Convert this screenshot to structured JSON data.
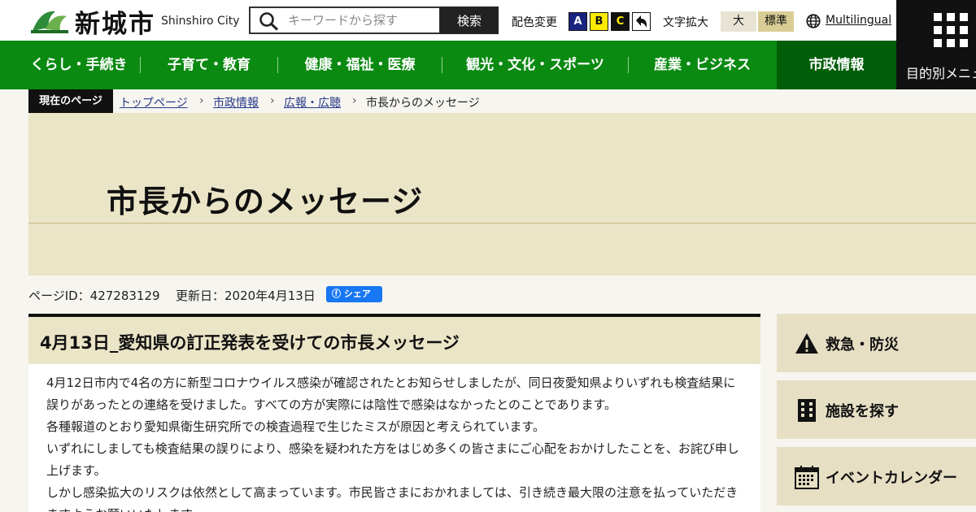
{
  "header": {
    "site_name": "新城市",
    "site_name_en": "Shinshiro City",
    "search": {
      "placeholder": "キーワードから探す",
      "button_label": "検索"
    },
    "color_change": {
      "label": "配色変更",
      "options": [
        "A",
        "B",
        "C"
      ]
    },
    "font_size": {
      "label": "文字拡大",
      "large_label": "大",
      "standard_label": "標準"
    },
    "multilingual_label": "Multilingual",
    "purpose_menu_label": "目的別メニュー"
  },
  "global_nav": {
    "items": [
      {
        "label": "くらし・手続き"
      },
      {
        "label": "子育て・教育"
      },
      {
        "label": "健康・福祉・医療"
      },
      {
        "label": "観光・文化・スポーツ"
      },
      {
        "label": "産業・ビジネス"
      },
      {
        "label": "市政情報"
      }
    ]
  },
  "breadcrumb": {
    "current_label": "現在のページ",
    "items": [
      {
        "label": "トップページ"
      },
      {
        "label": "市政情報"
      },
      {
        "label": "広報・広聴"
      },
      {
        "label": "市長からのメッセージ"
      }
    ]
  },
  "hero": {
    "title": "市長からのメッセージ"
  },
  "meta": {
    "page_id": "ページID：427283129",
    "updated": "更新日：2020年4月13日",
    "share_label": "シェア"
  },
  "article": {
    "title": "4月13日_愛知県の訂正発表を受けての市長メッセージ",
    "paragraphs": [
      "4月12日市内で4名の方に新型コロナウイルス感染が確認されたとお知らせしましたが、同日夜愛知県よりいずれも検査結果に誤りがあったとの連絡を受けました。すべての方が実際には陰性で感染はなかったとのことであります。",
      "各種報道のとおり愛知県衛生研究所での検査過程で生じたミスが原因と考えられています。",
      "いずれにしましても検査結果の誤りにより、感染を疑われた方をはじめ多くの皆さまにご心配をおかけしたことを、お詫び申し上げます。",
      "しかし感染拡大のリスクは依然として高まっています。市民皆さまにおかれましては、引き続き最大限の注意を払っていただきますようお願いいたします。"
    ]
  },
  "sidebar": {
    "items": [
      {
        "label": "救急・防災",
        "icon": "warning-icon"
      },
      {
        "label": "施設を探す",
        "icon": "building-icon"
      },
      {
        "label": "イベントカレンダー",
        "icon": "calendar-icon"
      }
    ]
  },
  "colors": {
    "nav_green": "#0b8a12",
    "nav_active": "#005d08",
    "hero_beige": "#ebe5c7",
    "side_beige": "#e6dfc4"
  }
}
